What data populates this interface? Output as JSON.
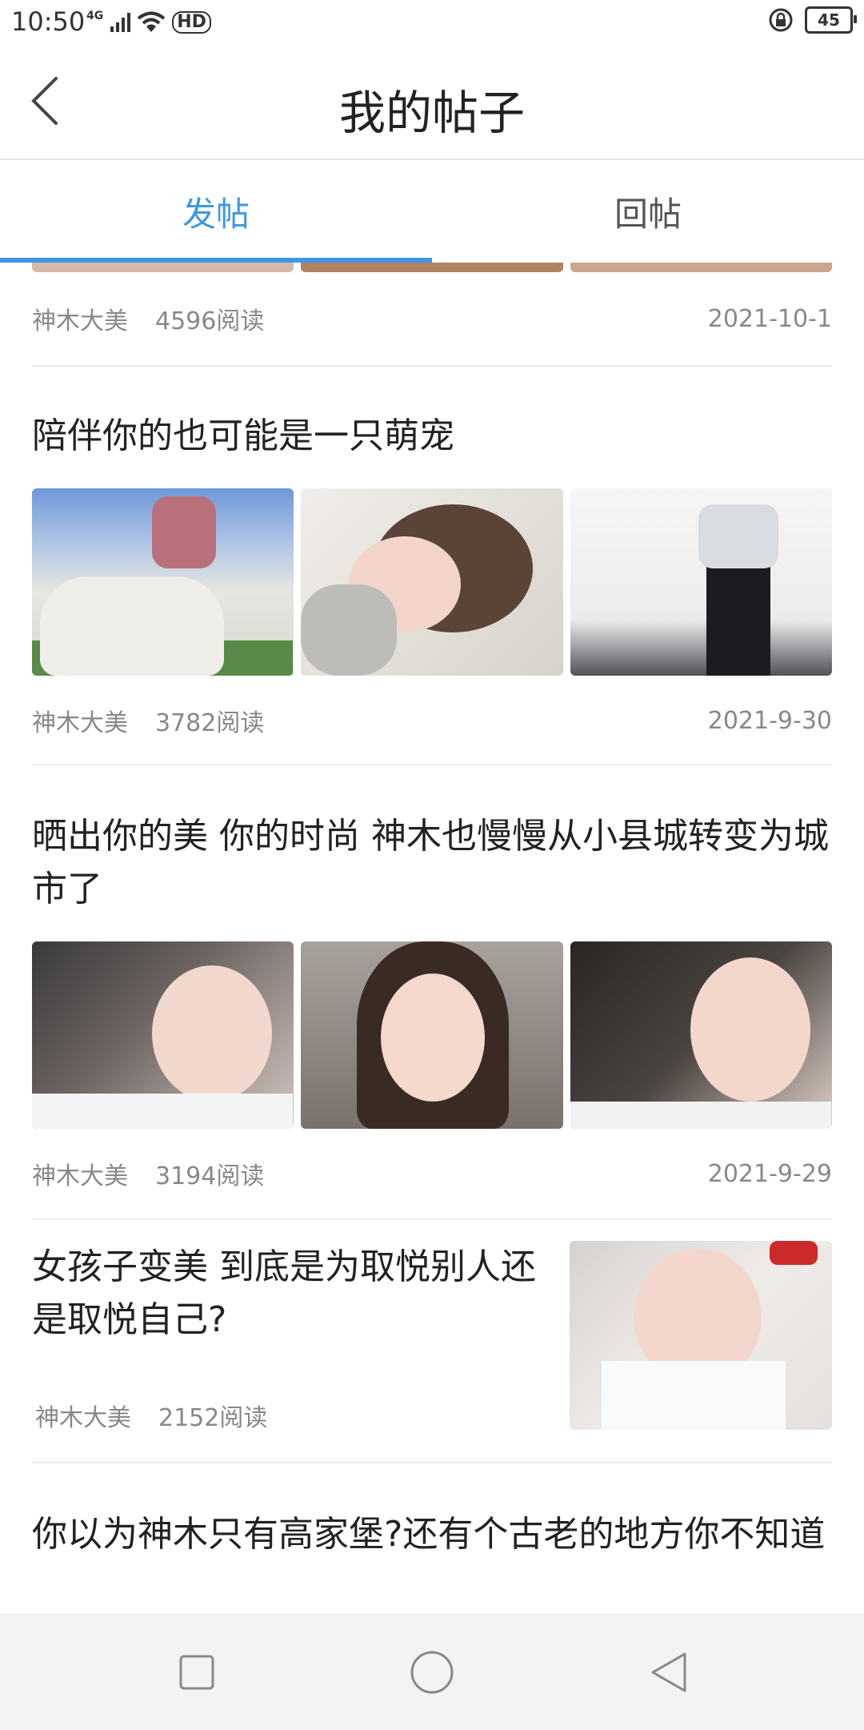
{
  "status": {
    "time": "10:50",
    "network": "4G",
    "hd": "HD",
    "battery": "45"
  },
  "header": {
    "title": "我的帖子"
  },
  "tabs": [
    {
      "label": "发帖"
    },
    {
      "label": "回帖"
    }
  ],
  "posts": [
    {
      "title": "",
      "author": "神木大美",
      "reads": "4596阅读",
      "date": "2021-10-1"
    },
    {
      "title": "陪伴你的也可能是一只萌宠",
      "author": "神木大美",
      "reads": "3782阅读",
      "date": "2021-9-30"
    },
    {
      "title": "晒出你的美 你的时尚 神木也慢慢从小县城转变为城市了",
      "author": "神木大美",
      "reads": "3194阅读",
      "date": "2021-9-29"
    },
    {
      "title": "女孩子变美 到底是为取悦别人还是取悦自己?",
      "author": "神木大美",
      "reads": "2152阅读",
      "date": ""
    },
    {
      "title": "你以为神木只有高家堡?还有个古老的地方你不知道",
      "author": "",
      "reads": "",
      "date": ""
    }
  ],
  "icons": {
    "back": "chevron-left-icon",
    "recent": "square-icon",
    "home": "circle-icon",
    "nav_back": "triangle-back-icon"
  },
  "colors": {
    "accent": "#3e97e6",
    "meta": "#888888"
  }
}
